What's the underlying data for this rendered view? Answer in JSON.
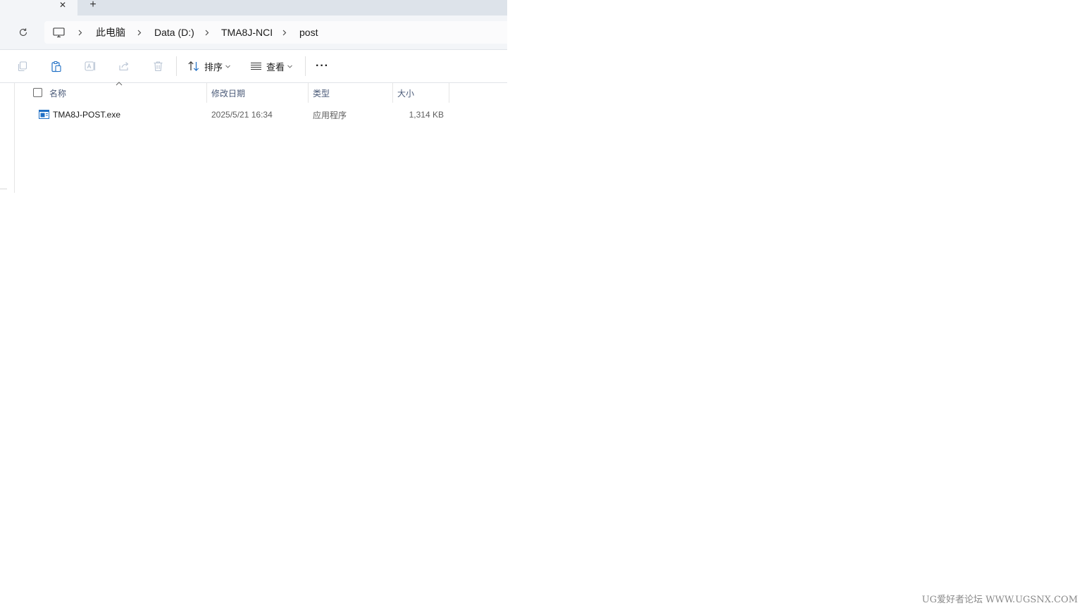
{
  "tabs": {
    "close_symbol": "✕",
    "new_tab_symbol": "+"
  },
  "address_bar": {
    "breadcrumbs": [
      {
        "label": "此电脑"
      },
      {
        "label": "Data (D:)"
      },
      {
        "label": "TMA8J-NCI"
      },
      {
        "label": "post"
      }
    ]
  },
  "toolbar": {
    "sort_label": "排序",
    "view_label": "查看",
    "more_label": "···"
  },
  "file_list": {
    "columns": {
      "name": "名称",
      "date": "修改日期",
      "type": "类型",
      "size": "大小"
    },
    "rows": [
      {
        "name": "TMA8J-POST.exe",
        "date": "2025/5/21 16:34",
        "type": "应用程序",
        "size": "1,314 KB",
        "icon": "application-exe-icon"
      }
    ]
  },
  "watermark": {
    "text": "UG爱好者论坛 WWW.UGSNX.COM"
  },
  "colors": {
    "accent": "#4a5a78",
    "tab_strip": "#dde3ea",
    "address_row": "#f3f5f8",
    "icon_blue": "#1f6fc5"
  }
}
